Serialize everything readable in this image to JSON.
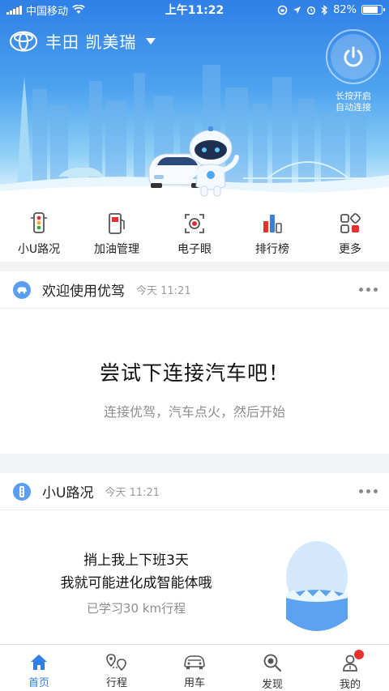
{
  "status_bar": {
    "carrier": "中国移动",
    "time": "上午11:22",
    "battery": "82%",
    "battery_level": 0.82
  },
  "header": {
    "car_name": "丰田 凯美瑞",
    "power_hint_line1": "长按开启",
    "power_hint_line2": "自动连接"
  },
  "quick_menu": [
    {
      "label": "小U路况",
      "icon": "traffic-light-icon"
    },
    {
      "label": "加油管理",
      "icon": "fuel-pump-icon"
    },
    {
      "label": "电子眼",
      "icon": "camera-eye-icon"
    },
    {
      "label": "排行榜",
      "icon": "ranking-bars-icon"
    },
    {
      "label": "更多",
      "icon": "grid-more-icon"
    }
  ],
  "welcome_card": {
    "title": "欢迎使用优驾",
    "time": "今天 11:21",
    "headline": "尝试下连接汽车吧！",
    "subline": "连接优驾，汽车点火，然后开始"
  },
  "traffic_card": {
    "title": "小U路况",
    "time": "今天 11:21",
    "line1": "捎上我上下班3天",
    "line2": "我就可能进化成智能体哦",
    "line3": "已学习30 km行程"
  },
  "tabbar": [
    {
      "label": "首页",
      "icon": "home-icon",
      "active": true
    },
    {
      "label": "行程",
      "icon": "route-pin-icon",
      "active": false
    },
    {
      "label": "用车",
      "icon": "car-icon",
      "active": false
    },
    {
      "label": "发现",
      "icon": "search-icon",
      "active": false
    },
    {
      "label": "我的",
      "icon": "profile-icon",
      "active": false
    }
  ],
  "colors": {
    "accent": "#2f7fe6",
    "hero_top": "#2f7fe6",
    "badge": "#5b9ef0",
    "notify_dot": "#e8312f"
  }
}
